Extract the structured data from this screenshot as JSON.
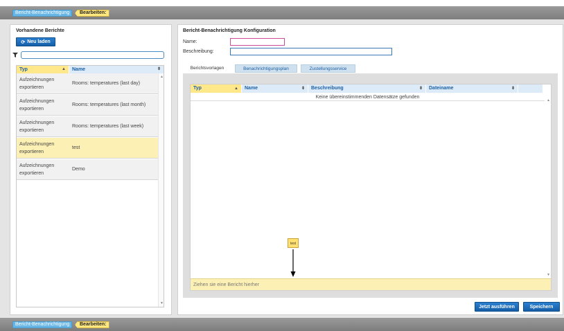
{
  "breadcrumb": {
    "report_notification": "Bericht-Benachrichtigung",
    "edit": "Bearbeiten:"
  },
  "left": {
    "title": "Vorhandene Berichte",
    "reload_label": "Neu laden",
    "reload_icon": "refresh-icon",
    "filter_icon": "filter-icon",
    "filter_value": "",
    "columns": [
      "Typ",
      "Name"
    ],
    "rows": [
      {
        "type_line1": "Aufzeichnungen",
        "type_line2": "exportieren",
        "name": "Rooms: temperatures (last day)",
        "selected": false
      },
      {
        "type_line1": "Aufzeichnungen",
        "type_line2": "exportieren",
        "name": "Rooms: temperatures (last month)",
        "selected": false
      },
      {
        "type_line1": "Aufzeichnungen",
        "type_line2": "exportieren",
        "name": "Rooms: temperatures (last week)",
        "selected": false
      },
      {
        "type_line1": "Aufzeichnungen",
        "type_line2": "exportieren",
        "name": "test",
        "selected": true
      },
      {
        "type_line1": "Aufzeichnungen",
        "type_line2": "exportieren",
        "name": "Demo",
        "selected": false
      }
    ]
  },
  "right": {
    "title": "Bericht-Benachrichtigung Konfiguration",
    "name_label": "Name:",
    "name_value": "",
    "description_label": "Beschreibung:",
    "description_value": "",
    "tabs": [
      "Berichtsvorlagen",
      "Benachrichtigungsplan",
      "Zustellungsservice"
    ],
    "active_tab": 0,
    "grid_columns": [
      "Typ",
      "Name",
      "Beschreibung",
      "Dateiname"
    ],
    "empty_message": "Keine übereinstimmenden Datensätze gefunden",
    "drop_hint": "Ziehen sie eine Bericht hierher",
    "drag_chip": "test",
    "run_label": "Jetzt ausführen",
    "save_label": "Speichern"
  },
  "colors": {
    "accent_blue": "#1c5fa5",
    "selection_yellow": "#fdf0b5",
    "header_yellow": "#ffe88a"
  }
}
